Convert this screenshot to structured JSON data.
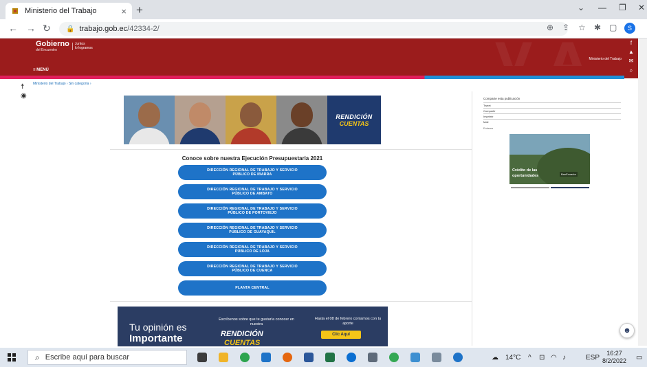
{
  "browser": {
    "tab_title": "Ministerio del Trabajo",
    "tab_close": "×",
    "new_tab": "+",
    "url_host": "trabajo.gob.ec",
    "url_path": "/42334-2/",
    "profile_initial": "S"
  },
  "site": {
    "logo_main": "Gobierno",
    "logo_sub": "del Encuentro",
    "logo_slogan_1": "Juntos",
    "logo_slogan_2": "lo logramos",
    "ministry_label": "Ministerio del Trabajo",
    "menu_label": "≡ MENÚ",
    "social": [
      "f",
      "▲",
      "✉"
    ],
    "search_icon": "search-icon"
  },
  "breadcrumb": "Ministerio del Trabajo › Sin categoría ›",
  "hero": {
    "rendicion_1": "RENDICIÓN",
    "rendicion_2": "CUENTAS"
  },
  "section_title": "Conoce sobre nuestra Ejecución Presupuestaria 2021",
  "buttons": [
    "DIRECCIÓN REGIONAL DE TRABAJO Y SERVICIO PÚBLICO DE IBARRA",
    "DIRECCIÓN REGIONAL DE TRABAJO Y SERVICIO PÚBLICO DE AMBATO",
    "DIRECCIÓN REGIONAL DE TRABAJO Y SERVICIO PÚBLICO DE PORTOVIEJO",
    "DIRECCIÓN REGIONAL DE TRABAJO Y SERVICIO PÚBLICO DE GUAYAQUIL",
    "DIRECCIÓN REGIONAL DE TRABAJO Y SERVICIO PÚBLICO DE LOJA",
    "DIRECCIÓN REGIONAL DE TRABAJO Y SERVICIO PÚBLICO DE CUENCA",
    "PLANTA CENTRAL"
  ],
  "banner": {
    "opinion_1": "Tu opinión es",
    "opinion_2": "Importante",
    "mid_text": "Escríbenos sobre que te gustaría conocer en nuestra",
    "mid_rendicion": "RENDICIÓN",
    "mid_cuentas": "CUENTAS",
    "right_text": "Hasta el 08 de febrero contamos con tu aporte",
    "clic": "Clic Aquí"
  },
  "share": {
    "title": "Comparte esta publicación",
    "items": [
      "Tweet",
      "Compartir",
      "Imprimir",
      "Mail"
    ],
    "enlaces": "Enlaces"
  },
  "promo": {
    "line1": "Crédito de las",
    "line2": "oportunidades",
    "tag": "BanEcuador"
  },
  "taskbar": {
    "search_placeholder": "Escribe aquí para buscar",
    "weather": "14°C",
    "lang": "ESP",
    "time": "16:27",
    "date": "8/2/2022"
  },
  "colors": {
    "header_red": "#9b1c1c",
    "button_blue": "#1e73c8",
    "banner_navy": "#2b3d63",
    "accent_yellow": "#f5c518"
  }
}
